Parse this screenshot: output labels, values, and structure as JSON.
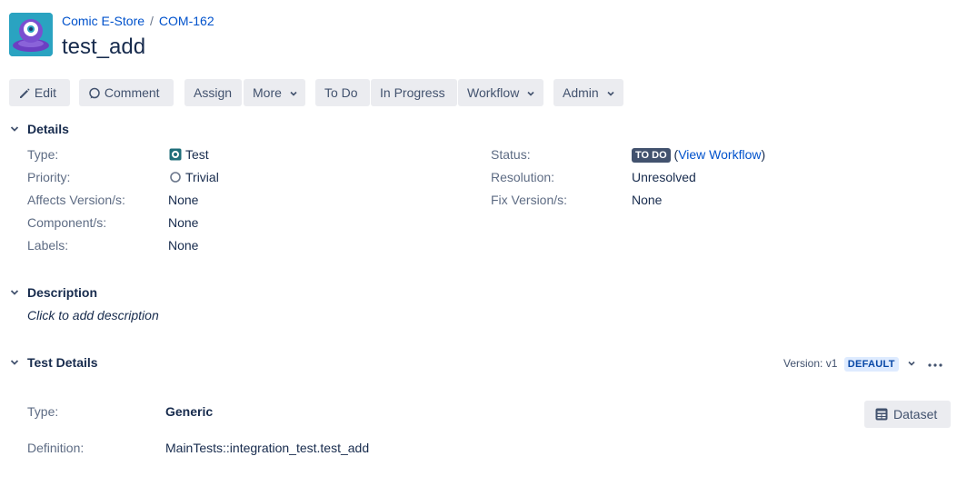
{
  "header": {
    "breadcrumb": {
      "project": "Comic E-Store",
      "separator": "/",
      "issue_key": "COM-162"
    },
    "title": "test_add"
  },
  "toolbar": {
    "edit": "Edit",
    "comment": "Comment",
    "assign": "Assign",
    "more": "More",
    "todo": "To Do",
    "in_progress": "In Progress",
    "workflow": "Workflow",
    "admin": "Admin"
  },
  "details": {
    "heading": "Details",
    "type_label": "Type:",
    "type_value": "Test",
    "priority_label": "Priority:",
    "priority_value": "Trivial",
    "affects_label": "Affects Version/s:",
    "affects_value": "None",
    "component_label": "Component/s:",
    "component_value": "None",
    "labels_label": "Labels:",
    "labels_value": "None",
    "status_label": "Status:",
    "status_value": "TO DO",
    "status_paren_open": "(",
    "view_workflow": "View Workflow",
    "status_paren_close": ")",
    "resolution_label": "Resolution:",
    "resolution_value": "Unresolved",
    "fix_label": "Fix Version/s:",
    "fix_value": "None"
  },
  "description": {
    "heading": "Description",
    "placeholder": "Click to add description"
  },
  "test_details": {
    "heading": "Test Details",
    "version_label": "Version: v1",
    "version_badge": "DEFAULT",
    "type_label": "Type:",
    "type_value": "Generic",
    "definition_label": "Definition:",
    "definition_value": "MainTests::integration_test.test_add",
    "dataset_button": "Dataset"
  },
  "colors": {
    "link": "#0052cc",
    "button_bg": "#ebecf0",
    "status_lozenge": "#42526e",
    "default_badge_bg": "#deebff",
    "test_icon": "#1f6e7a"
  },
  "icons": {
    "project": "alien-avatar-icon",
    "edit": "pencil-icon",
    "comment": "comment-icon",
    "dropdown": "chevron-down-icon",
    "section_toggle": "chevron-down-icon",
    "test_type": "test-icon",
    "priority": "trivial-circle-icon",
    "more": "ellipsis-icon",
    "dataset": "table-icon"
  }
}
